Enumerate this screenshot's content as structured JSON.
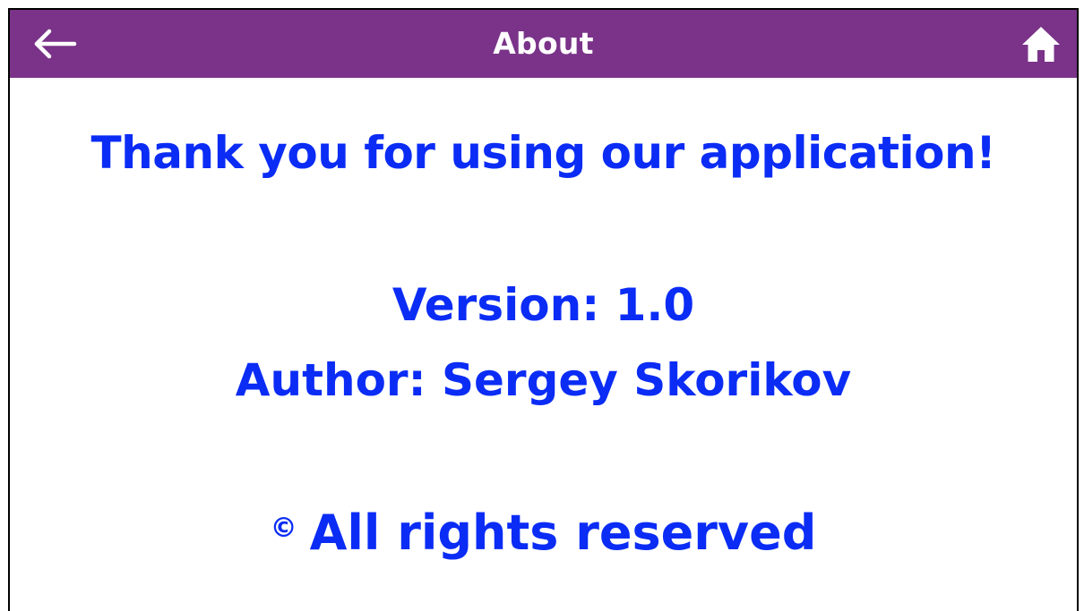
{
  "header": {
    "title": "About",
    "back_icon": "arrow-left-icon",
    "home_icon": "home-icon",
    "background_color": "#7a3389",
    "text_color": "#ffffff"
  },
  "main": {
    "thanks_text": "Thank you for using our application!",
    "version_text": "Version: 1.0",
    "author_text": "Author: Sergey Skorikov",
    "copyright_symbol": "©",
    "rights_text": "All rights reserved",
    "text_color": "#0b2cf5"
  }
}
